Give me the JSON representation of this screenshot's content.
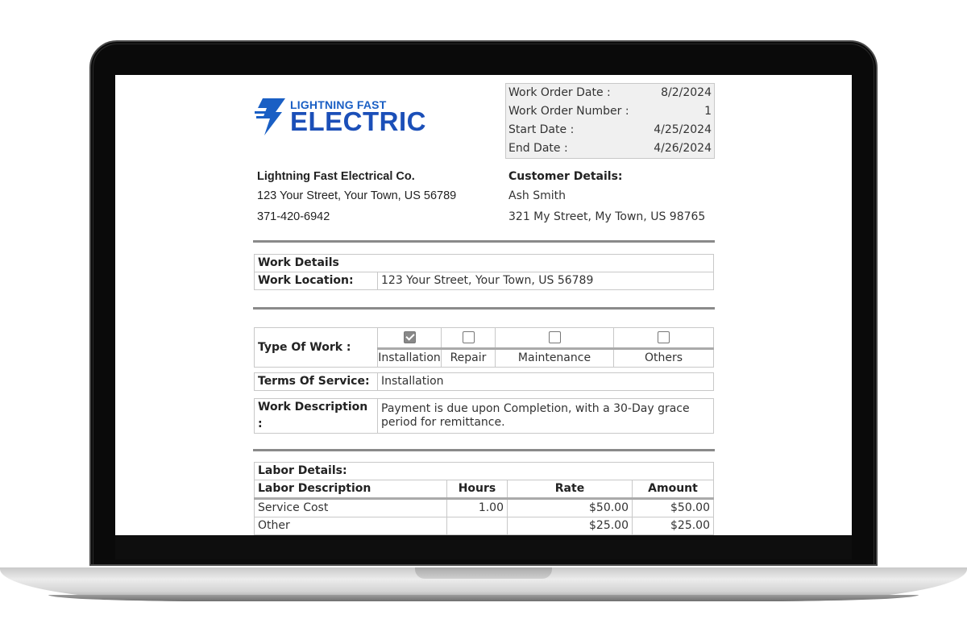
{
  "logo": {
    "top_text": "LIGHTNING FAST",
    "main_text": "ELECTRIC",
    "icon": "lightning-bolt-icon",
    "color": "#1b4fb8"
  },
  "header_info": [
    {
      "label": "Work Order Date :",
      "value": "8/2/2024"
    },
    {
      "label": "Work Order Number :",
      "value": "1"
    },
    {
      "label": "Start Date :",
      "value": "4/25/2024"
    },
    {
      "label": "End Date :",
      "value": "4/26/2024"
    }
  ],
  "company": {
    "name": "Lightning Fast Electrical Co.",
    "address": "123 Your Street, Your Town, US 56789",
    "phone": "371-420-6942"
  },
  "customer": {
    "heading": "Customer Details:",
    "name": "Ash Smith",
    "address": "321 My Street, My Town, US 98765"
  },
  "work_details": {
    "heading": "Work Details",
    "location_label": "Work Location:",
    "location_value": "123 Your Street, Your Town, US 56789"
  },
  "type_of_work": {
    "label": "Type Of Work :",
    "options": [
      {
        "label": "Installation",
        "checked": true
      },
      {
        "label": "Repair",
        "checked": false
      },
      {
        "label": "Maintenance",
        "checked": false
      },
      {
        "label": "Others",
        "checked": false
      }
    ]
  },
  "terms": {
    "label": "Terms Of Service:",
    "value": "Installation"
  },
  "description": {
    "label": "Work Description :",
    "value_line1": "Payment is due upon Completion, with a 30-Day grace",
    "value_line2": "period for remittance."
  },
  "labor": {
    "heading": "Labor Details:",
    "columns": [
      "Labor Description",
      "Hours",
      "Rate",
      "Amount"
    ],
    "rows": [
      {
        "description": "Service Cost",
        "hours": "1.00",
        "rate": "$50.00",
        "amount": "$50.00"
      },
      {
        "description": "Other",
        "hours": "",
        "rate": "$25.00",
        "amount": "$25.00"
      }
    ]
  }
}
